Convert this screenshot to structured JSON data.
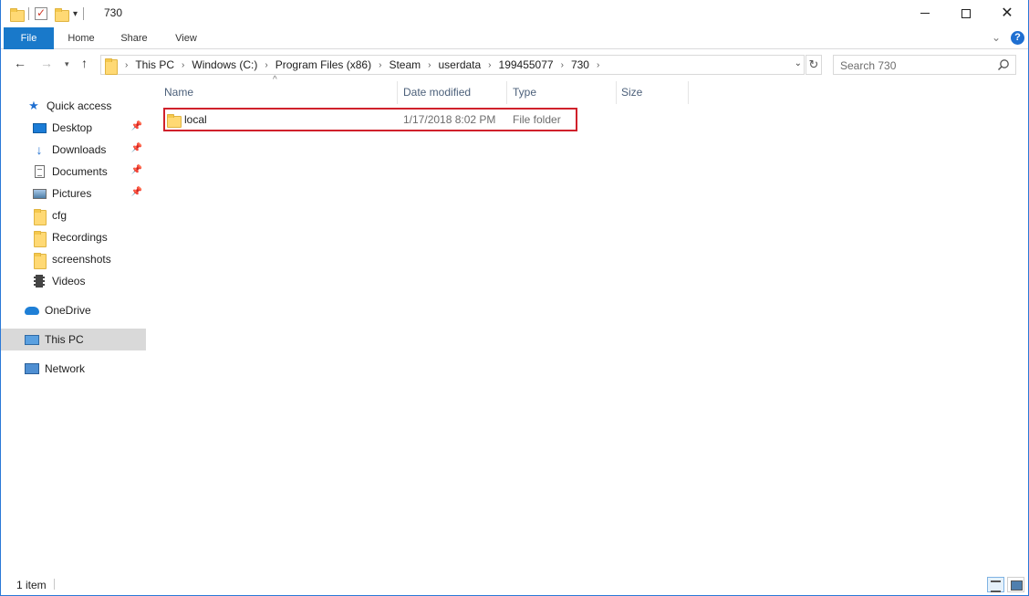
{
  "window": {
    "title": "730",
    "controls": {
      "minimize": "minimize",
      "maximize": "maximize",
      "close": "✕"
    }
  },
  "ribbon": {
    "tabs": [
      {
        "label": "File",
        "active": true
      },
      {
        "label": "Home"
      },
      {
        "label": "Share"
      },
      {
        "label": "View"
      }
    ],
    "help_label": "?"
  },
  "address_bar": {
    "breadcrumbs": [
      "This PC",
      "Windows (C:)",
      "Program Files (x86)",
      "Steam",
      "userdata",
      "199455077",
      "730"
    ]
  },
  "search": {
    "placeholder": "Search 730"
  },
  "nav_pane": {
    "quick_access_label": "Quick access",
    "items": [
      {
        "label": "Desktop",
        "icon": "desktop-icon",
        "pinned": true
      },
      {
        "label": "Downloads",
        "icon": "downloads-icon",
        "pinned": true
      },
      {
        "label": "Documents",
        "icon": "documents-icon",
        "pinned": true
      },
      {
        "label": "Pictures",
        "icon": "pictures-icon",
        "pinned": true
      },
      {
        "label": "cfg",
        "icon": "folder-icon"
      },
      {
        "label": "Recordings",
        "icon": "folder-icon"
      },
      {
        "label": "screenshots",
        "icon": "folder-icon"
      },
      {
        "label": "Videos",
        "icon": "videos-icon"
      }
    ],
    "onedrive_label": "OneDrive",
    "this_pc_label": "This PC",
    "network_label": "Network"
  },
  "columns": {
    "name": "Name",
    "date_modified": "Date modified",
    "type": "Type",
    "size": "Size"
  },
  "files": [
    {
      "name": "local",
      "date_modified": "1/17/2018 8:02 PM",
      "type": "File folder",
      "size": ""
    }
  ],
  "status": {
    "item_count": "1 item"
  },
  "colors": {
    "accent": "#1979ca",
    "highlight_border": "#d0212b",
    "selected_nav": "#d9d9d9"
  }
}
